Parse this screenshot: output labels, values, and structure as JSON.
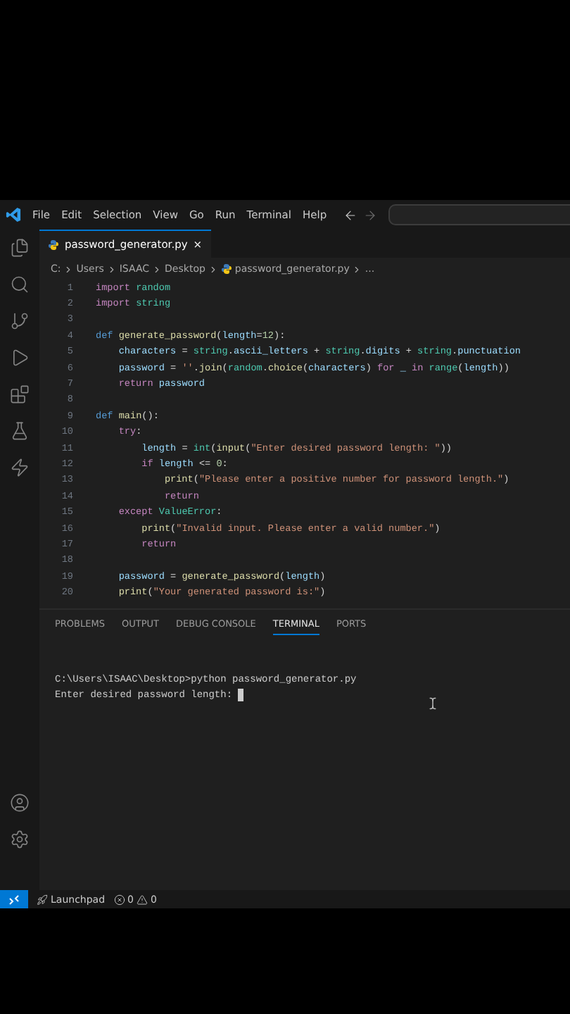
{
  "menu": [
    "File",
    "Edit",
    "Selection",
    "View",
    "Go",
    "Run",
    "Terminal",
    "Help"
  ],
  "editor_tab": {
    "label": "password_generator.py",
    "close": "×",
    "selected": true
  },
  "breadcrumb": [
    {
      "text": "C:"
    },
    {
      "text": "Users"
    },
    {
      "text": "ISAAC"
    },
    {
      "text": "Desktop"
    },
    {
      "text": "password_generator.py",
      "kind": "file"
    },
    {
      "text": "..."
    }
  ],
  "code": [
    {
      "number": "1",
      "tokens": [
        {
          "kind": "kw",
          "text": "import"
        },
        {
          "kind": "mod",
          "text": " random"
        }
      ]
    },
    {
      "number": "2",
      "tokens": [
        {
          "kind": "kw",
          "text": "import"
        },
        {
          "kind": "mod",
          "text": " string"
        }
      ]
    },
    {
      "number": "3"
    },
    {
      "number": "4",
      "tokens": [
        {
          "kind": "def",
          "text": "def"
        },
        {
          "kind": "fn",
          "text": " generate_password"
        },
        {
          "kind": "plain",
          "text": "("
        },
        {
          "kind": "var",
          "text": "length"
        },
        {
          "kind": "plain",
          "text": "="
        },
        {
          "kind": "num",
          "text": "12"
        },
        {
          "kind": "plain",
          "text": "):"
        }
      ]
    },
    {
      "number": "5",
      "tokens": [
        {
          "kind": "var",
          "text": "    characters"
        },
        {
          "kind": "plain",
          "text": " = "
        },
        {
          "kind": "mod",
          "text": "string"
        },
        {
          "kind": "plain",
          "text": "."
        },
        {
          "kind": "var",
          "text": "ascii_letters"
        },
        {
          "kind": "plain",
          "text": " + "
        },
        {
          "kind": "mod",
          "text": "string"
        },
        {
          "kind": "plain",
          "text": "."
        },
        {
          "kind": "var",
          "text": "digits"
        },
        {
          "kind": "plain",
          "text": " + "
        },
        {
          "kind": "mod",
          "text": "string"
        },
        {
          "kind": "plain",
          "text": "."
        },
        {
          "kind": "var",
          "text": "punctuation"
        }
      ]
    },
    {
      "number": "6",
      "tokens": [
        {
          "kind": "var",
          "text": "    password"
        },
        {
          "kind": "plain",
          "text": " = "
        },
        {
          "kind": "str",
          "text": "''"
        },
        {
          "kind": "plain",
          "text": "."
        },
        {
          "kind": "fn",
          "text": "join"
        },
        {
          "kind": "plain",
          "text": "("
        },
        {
          "kind": "mod",
          "text": "random"
        },
        {
          "kind": "plain",
          "text": "."
        },
        {
          "kind": "fn",
          "text": "choice"
        },
        {
          "kind": "plain",
          "text": "("
        },
        {
          "kind": "var",
          "text": "characters"
        },
        {
          "kind": "plain",
          "text": ") "
        },
        {
          "kind": "kw",
          "text": "for"
        },
        {
          "kind": "var",
          "text": " _"
        },
        {
          "kind": "kw",
          "text": " in"
        },
        {
          "kind": "mod",
          "text": " range"
        },
        {
          "kind": "plain",
          "text": "("
        },
        {
          "kind": "var",
          "text": "length"
        },
        {
          "kind": "plain",
          "text": "))"
        }
      ]
    },
    {
      "number": "7",
      "tokens": [
        {
          "kind": "kw",
          "text": "    return"
        },
        {
          "kind": "var",
          "text": " password"
        }
      ]
    },
    {
      "number": "8"
    },
    {
      "number": "9",
      "tokens": [
        {
          "kind": "def",
          "text": "def"
        },
        {
          "kind": "fn",
          "text": " main"
        },
        {
          "kind": "plain",
          "text": "():"
        }
      ]
    },
    {
      "number": "10",
      "tokens": [
        {
          "kind": "kw",
          "text": "    try"
        },
        {
          "kind": "plain",
          "text": ":"
        }
      ]
    },
    {
      "number": "11",
      "tokens": [
        {
          "kind": "var",
          "text": "        length"
        },
        {
          "kind": "plain",
          "text": " = "
        },
        {
          "kind": "mod",
          "text": "int"
        },
        {
          "kind": "plain",
          "text": "("
        },
        {
          "kind": "fn",
          "text": "input"
        },
        {
          "kind": "plain",
          "text": "("
        },
        {
          "kind": "str",
          "text": "\"Enter desired password length: \""
        },
        {
          "kind": "plain",
          "text": "))"
        }
      ]
    },
    {
      "number": "12",
      "tokens": [
        {
          "kind": "kw",
          "text": "        if"
        },
        {
          "kind": "var",
          "text": " length"
        },
        {
          "kind": "plain",
          "text": " <= "
        },
        {
          "kind": "num",
          "text": "0"
        },
        {
          "kind": "plain",
          "text": ":"
        }
      ]
    },
    {
      "number": "13",
      "tokens": [
        {
          "kind": "fn",
          "text": "            print"
        },
        {
          "kind": "plain",
          "text": "("
        },
        {
          "kind": "str",
          "text": "\"Please enter a positive number for password length.\""
        },
        {
          "kind": "plain",
          "text": ")"
        }
      ]
    },
    {
      "number": "14",
      "tokens": [
        {
          "kind": "kw",
          "text": "            return"
        }
      ]
    },
    {
      "number": "15",
      "tokens": [
        {
          "kind": "kw",
          "text": "    except"
        },
        {
          "kind": "mod",
          "text": " ValueError"
        },
        {
          "kind": "plain",
          "text": ":"
        }
      ]
    },
    {
      "number": "16",
      "tokens": [
        {
          "kind": "fn",
          "text": "        print"
        },
        {
          "kind": "plain",
          "text": "("
        },
        {
          "kind": "str",
          "text": "\"Invalid input. Please enter a valid number.\""
        },
        {
          "kind": "plain",
          "text": ")"
        }
      ]
    },
    {
      "number": "17",
      "tokens": [
        {
          "kind": "kw",
          "text": "        return"
        }
      ]
    },
    {
      "number": "18"
    },
    {
      "number": "19",
      "tokens": [
        {
          "kind": "var",
          "text": "    password"
        },
        {
          "kind": "plain",
          "text": " = "
        },
        {
          "kind": "fn",
          "text": "generate_password"
        },
        {
          "kind": "plain",
          "text": "("
        },
        {
          "kind": "var",
          "text": "length"
        },
        {
          "kind": "plain",
          "text": ")"
        }
      ]
    },
    {
      "number": "20",
      "tokens": [
        {
          "kind": "fn",
          "text": "    print"
        },
        {
          "kind": "plain",
          "text": "("
        },
        {
          "kind": "str",
          "text": "\"Your generated password is:\""
        },
        {
          "kind": "plain",
          "text": ")"
        }
      ]
    }
  ],
  "panel_tabs": [
    {
      "label": "PROBLEMS",
      "selected": false
    },
    {
      "label": "OUTPUT",
      "selected": false
    },
    {
      "label": "DEBUG CONSOLE",
      "selected": false
    },
    {
      "label": "TERMINAL",
      "selected": true
    },
    {
      "label": "PORTS",
      "selected": false
    }
  ],
  "terminal": {
    "lines": [
      "C:\\Users\\ISAAC\\Desktop>python password_generator.py"
    ],
    "prompt": "Enter desired password length: "
  },
  "status_bar": {
    "launchpad": "Launchpad",
    "errors": "0",
    "warnings": "0"
  }
}
